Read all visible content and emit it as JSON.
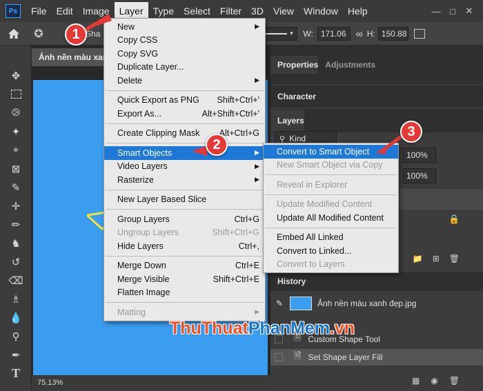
{
  "menubar": {
    "logo": "Ps",
    "items": [
      "File",
      "Edit",
      "Image",
      "Layer",
      "Type",
      "Select",
      "Filter",
      "3D",
      "View",
      "Window",
      "Help"
    ]
  },
  "optbar": {
    "shape_text": "Sha",
    "w_label": "W:",
    "w_value": "171.06",
    "link_icon": "link-icon",
    "h_label": "H:",
    "h_value": "150.88"
  },
  "document": {
    "tab_title": "Ảnh nền màu xan",
    "zoom": "75.13%",
    "canvas_color": "#3b9df0"
  },
  "panels": {
    "properties": "Properties",
    "adjustments": "Adjustments",
    "character": "Character",
    "layers": "Layers",
    "kind_label": "Kind",
    "opacity": "100%",
    "fill": "100%",
    "history_label": "History",
    "history_items": [
      {
        "label": "Ảnh nền màu xanh đẹp.jpg"
      },
      {
        "label": "Custom Shape Tool"
      },
      {
        "label": "Set Shape Layer Fill"
      }
    ]
  },
  "layer_menu": {
    "groups": [
      [
        {
          "label": "New",
          "submenu": true
        },
        {
          "label": "Copy CSS"
        },
        {
          "label": "Copy SVG"
        },
        {
          "label": "Duplicate Layer..."
        },
        {
          "label": "Delete",
          "submenu": true
        }
      ],
      [
        {
          "label": "Quick Export as PNG",
          "shortcut": "Shift+Ctrl+'"
        },
        {
          "label": "Export As...",
          "shortcut": "Alt+Shift+Ctrl+'"
        }
      ],
      [
        {
          "label": "Create Clipping Mask",
          "shortcut": "Alt+Ctrl+G"
        }
      ],
      [
        {
          "label": "Smart Objects",
          "submenu": true,
          "highlight": true
        },
        {
          "label": "Video Layers",
          "submenu": true
        },
        {
          "label": "Rasterize",
          "submenu": true
        }
      ],
      [
        {
          "label": "New Layer Based Slice"
        }
      ],
      [
        {
          "label": "Group Layers",
          "shortcut": "Ctrl+G"
        },
        {
          "label": "Ungroup Layers",
          "shortcut": "Shift+Ctrl+G",
          "disabled": true
        },
        {
          "label": "Hide Layers",
          "shortcut": "Ctrl+,"
        }
      ],
      [
        {
          "label": "Merge Down",
          "shortcut": "Ctrl+E"
        },
        {
          "label": "Merge Visible",
          "shortcut": "Shift+Ctrl+E"
        },
        {
          "label": "Flatten Image"
        }
      ],
      [
        {
          "label": "Matting",
          "submenu": true,
          "disabled": true
        }
      ]
    ]
  },
  "smart_menu": {
    "groups": [
      [
        {
          "label": "Convert to Smart Object",
          "highlight": true
        },
        {
          "label": "New Smart Object via Copy",
          "disabled": true
        }
      ],
      [
        {
          "label": "Reveal in Explorer",
          "disabled": true
        }
      ],
      [
        {
          "label": "Update Modified Content",
          "disabled": true
        },
        {
          "label": "Update All Modified Content"
        }
      ],
      [
        {
          "label": "Embed All Linked"
        },
        {
          "label": "Convert to Linked..."
        },
        {
          "label": "Convert to Layers",
          "disabled": true
        }
      ]
    ]
  },
  "markers": [
    "1",
    "2",
    "3"
  ],
  "watermark": {
    "part1": "ThuThuat",
    "part2": "PhanMem",
    "part3": ".vn"
  },
  "colors": {
    "accent": "#1e78d7",
    "marker": "#e53935",
    "canvas": "#3b9df0"
  }
}
